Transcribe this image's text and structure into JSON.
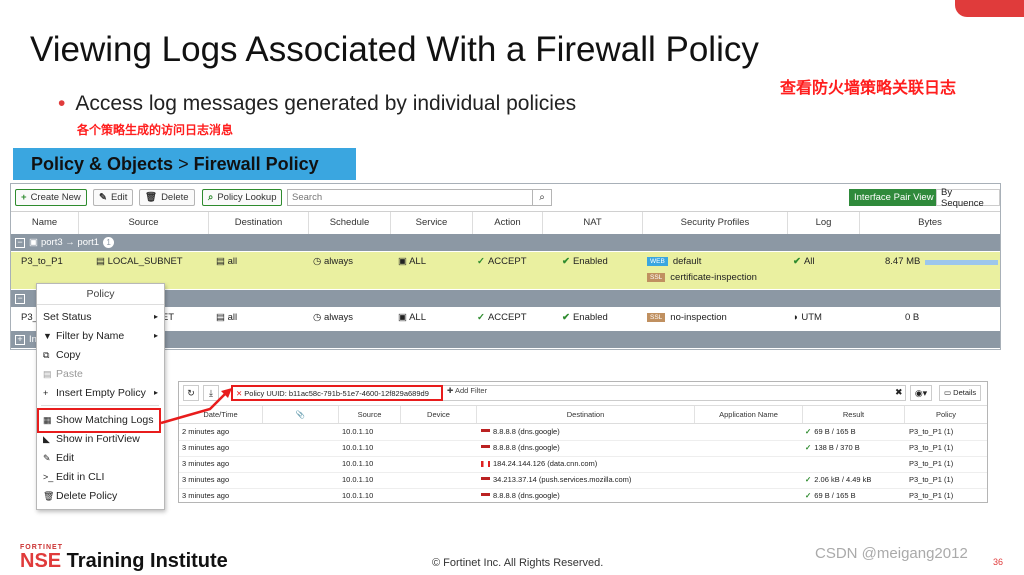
{
  "slide": {
    "title": "Viewing Logs Associated With a Firewall Policy",
    "title_cn": "查看防火墙策略关联日志",
    "bullet": "Access log messages generated by individual policies",
    "bullet_cn": "各个策略生成的访问日志消息",
    "breadcrumb": {
      "part1": "Policy & Objects",
      "sep": ">",
      "part2": "Firewall Policy"
    },
    "footer": {
      "brand_small": "FORTINET",
      "brand_nse": "NSE",
      "brand_rest": " Training Institute",
      "copyright": "© Fortinet Inc. All Rights Reserved.",
      "watermark": "CSDN @meigang2012",
      "page_number": "36"
    }
  },
  "policy_toolbar": {
    "create_new": "Create New",
    "edit": "Edit",
    "delete": "Delete",
    "policy_lookup": "Policy Lookup",
    "search_placeholder": "Search",
    "interface_pair_view": "Interface Pair View",
    "by_sequence": "By Sequence"
  },
  "policy_columns": [
    "Name",
    "Source",
    "Destination",
    "Schedule",
    "Service",
    "Action",
    "NAT",
    "Security Profiles",
    "Log",
    "Bytes"
  ],
  "policy_groups": [
    {
      "label": "port3 → port1",
      "count": "1"
    },
    {
      "label": ""
    },
    {
      "label": "In"
    }
  ],
  "policy_rows": [
    {
      "name": "P3_to_P1",
      "source": "LOCAL_SUBNET",
      "destination": "all",
      "schedule": "always",
      "service": "ALL",
      "action": "ACCEPT",
      "nat": "Enabled",
      "profile1_tag": "WEB",
      "profile1": "default",
      "profile2_tag": "SSL",
      "profile2": "certificate-inspection",
      "log": "All",
      "bytes": "8.47 MB",
      "bytes_fraction": 1.0
    },
    {
      "name": "P3_",
      "source": "NET",
      "destination": "all",
      "schedule": "always",
      "service": "ALL",
      "action": "ACCEPT",
      "nat": "Enabled",
      "profile1_tag": "SSL",
      "profile1": "no-inspection",
      "log": "UTM",
      "bytes": "0 B"
    }
  ],
  "context_menu": {
    "header": "Policy",
    "items": [
      {
        "label": "Set Status",
        "icon": "none"
      },
      {
        "label": "Filter by Name",
        "icon": "filter-icon"
      },
      {
        "label": "Copy",
        "icon": "copy-icon"
      },
      {
        "label": "Paste",
        "icon": "paste-icon"
      },
      {
        "label": "Insert Empty Policy",
        "icon": "plus-icon"
      },
      {
        "label": "Show Matching Logs",
        "icon": "logs-icon"
      },
      {
        "label": "Show in FortiView",
        "icon": "fortiview-icon"
      },
      {
        "label": "Edit",
        "icon": "pencil-icon"
      },
      {
        "label": "Edit in CLI",
        "icon": "cli-icon"
      },
      {
        "label": "Delete Policy",
        "icon": "trash-icon"
      }
    ]
  },
  "log_view": {
    "filter_text": "Policy UUID: b11ac58c-791b-51e7-4600-12f829a689d9",
    "add_filter": "Add Filter",
    "details": "Details",
    "columns": [
      "Date/Time",
      "",
      "Source",
      "Device",
      "Destination",
      "Application Name",
      "Result",
      "Policy"
    ],
    "rows": [
      {
        "time": "2 minutes ago",
        "source": "10.0.1.10",
        "device": "",
        "destination": "8.8.8.8 (dns.google)",
        "flag": "US",
        "app": "",
        "result": "69 B / 165 B",
        "result_ok": true,
        "policy": "P3_to_P1 (1)"
      },
      {
        "time": "3 minutes ago",
        "source": "10.0.1.10",
        "device": "",
        "destination": "8.8.8.8 (dns.google)",
        "flag": "US",
        "app": "",
        "result": "138 B / 370 B",
        "result_ok": true,
        "policy": "P3_to_P1 (1)"
      },
      {
        "time": "3 minutes ago",
        "source": "10.0.1.10",
        "device": "",
        "destination": "184.24.144.126 (data.cnn.com)",
        "flag": "CA",
        "app": "",
        "result": "",
        "result_ok": false,
        "policy": "P3_to_P1 (1)"
      },
      {
        "time": "3 minutes ago",
        "source": "10.0.1.10",
        "device": "",
        "destination": "34.213.37.14 (push.services.mozilla.com)",
        "flag": "US",
        "app": "",
        "result": "2.06 kB / 4.49 kB",
        "result_ok": true,
        "policy": "P3_to_P1 (1)"
      },
      {
        "time": "3 minutes ago",
        "source": "10.0.1.10",
        "device": "",
        "destination": "8.8.8.8 (dns.google)",
        "flag": "US",
        "app": "",
        "result": "69 B / 165 B",
        "result_ok": true,
        "policy": "P3_to_P1 (1)"
      }
    ]
  },
  "colors": {
    "accent_red": "#e81c1c",
    "breadcrumb_blue": "#3aa6e0",
    "selected_row": "#eaf0a0",
    "group_gray": "#8c98a4",
    "fortinet_green": "#2f8a3b"
  }
}
